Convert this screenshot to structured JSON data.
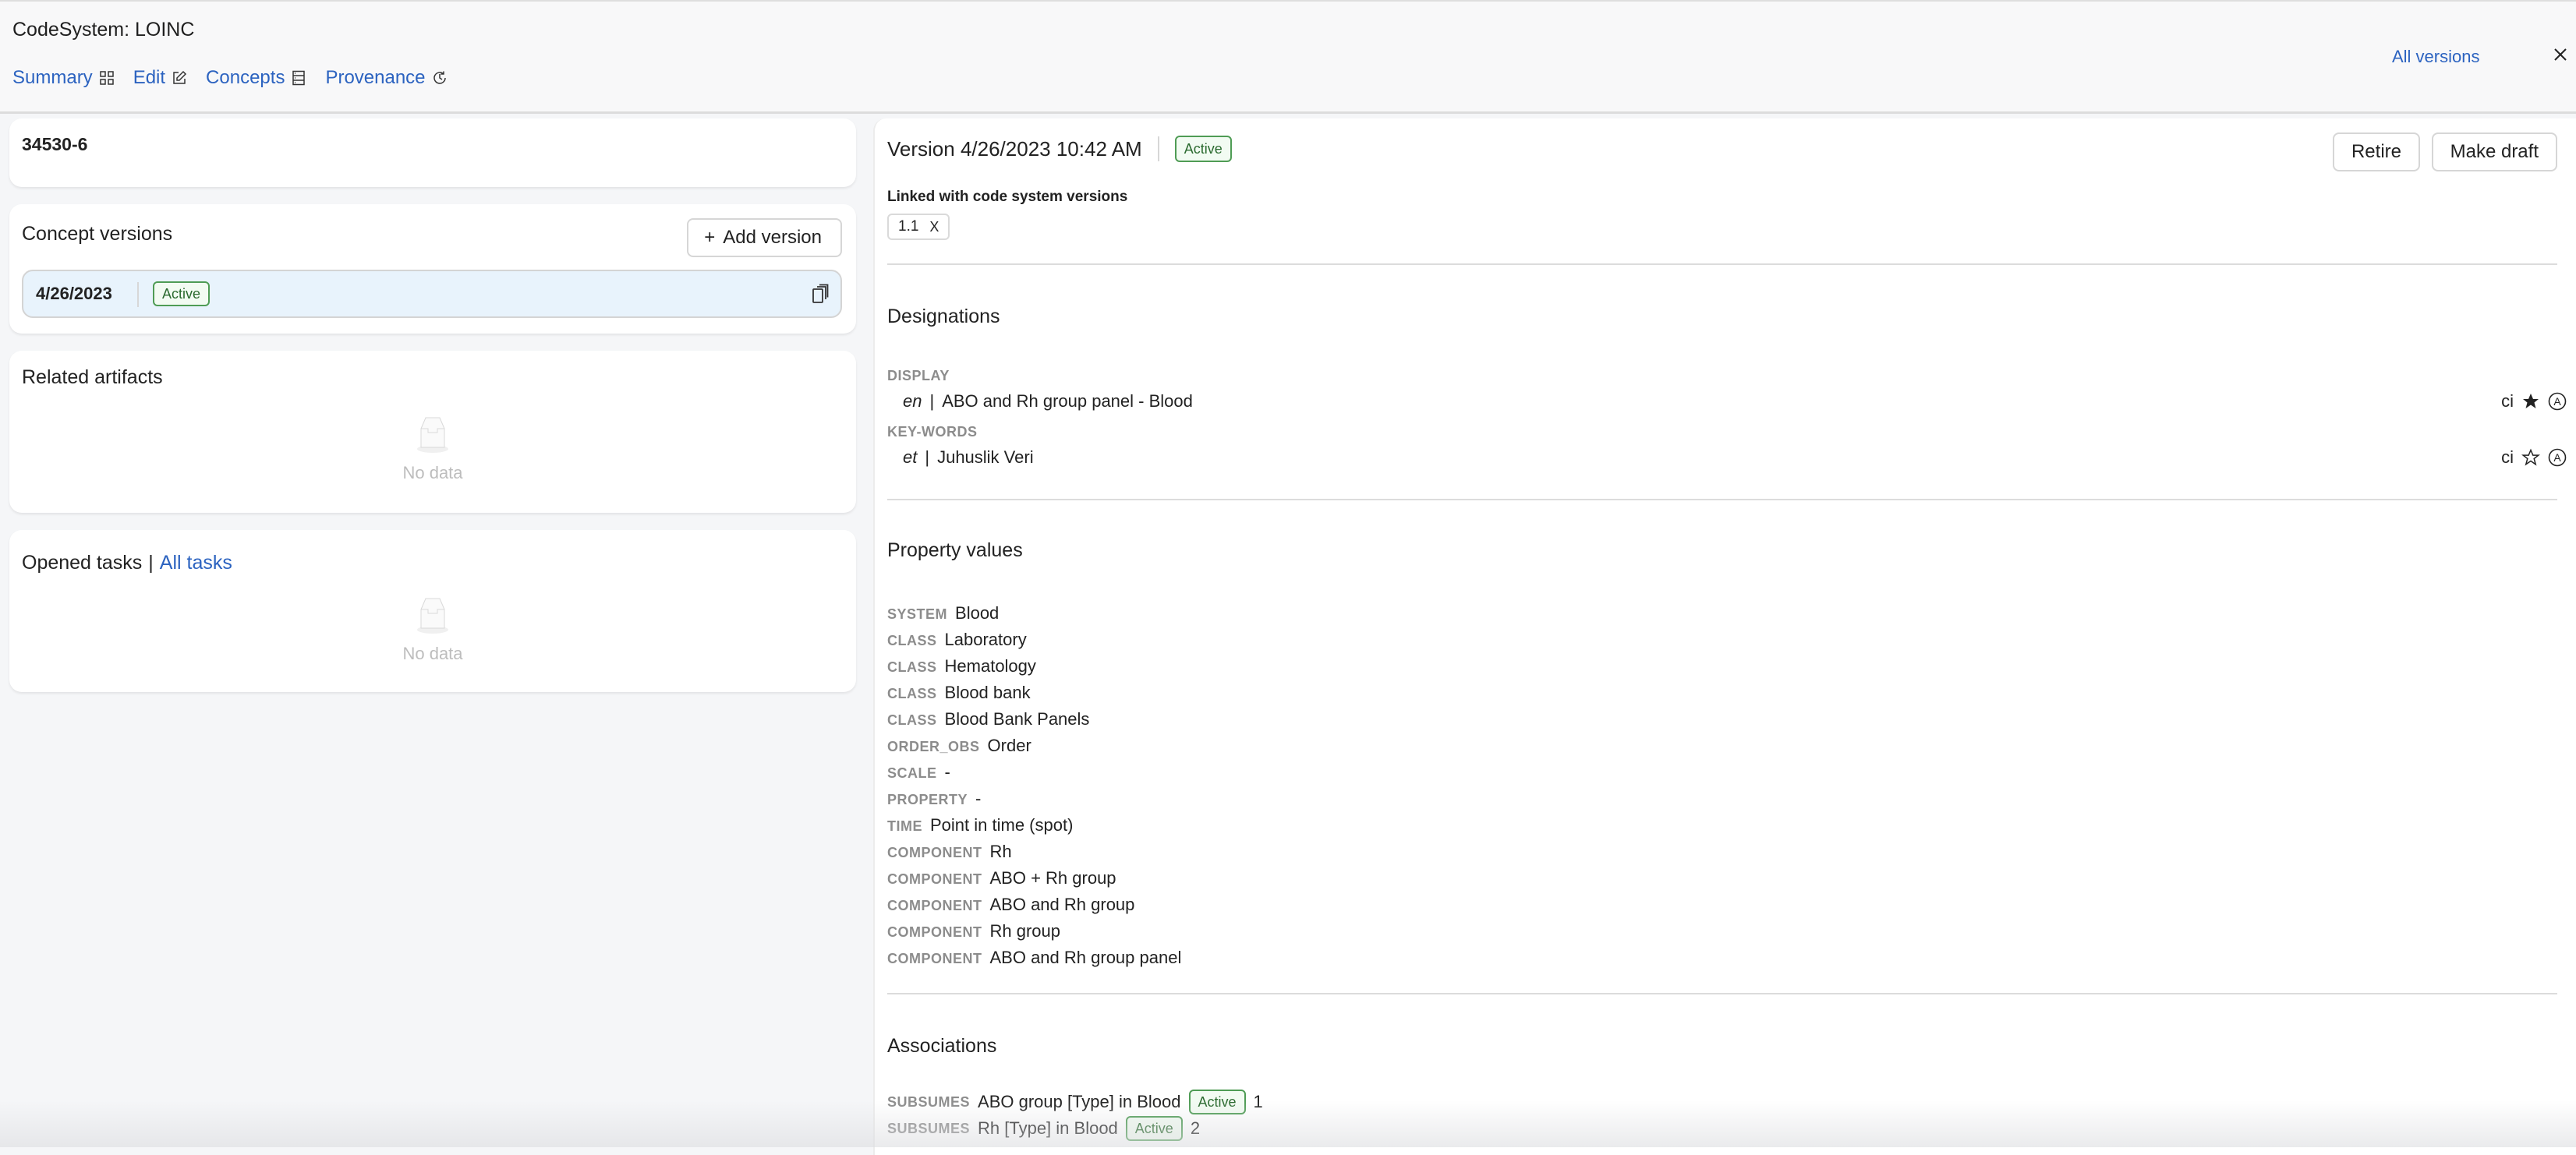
{
  "header": {
    "title": "CodeSystem: LOINC",
    "tabs": [
      {
        "label": "Summary",
        "icon": "grid-icon"
      },
      {
        "label": "Edit",
        "icon": "edit-icon"
      },
      {
        "label": "Concepts",
        "icon": "list-icon"
      },
      {
        "label": "Provenance",
        "icon": "history-icon"
      }
    ],
    "all_versions": "All versions",
    "close_icon": "close-icon"
  },
  "left": {
    "concept_code": "34530-6",
    "concept_versions": {
      "title": "Concept versions",
      "add_button": "Add version",
      "add_icon": "+",
      "items": [
        {
          "date": "4/26/2023",
          "status": "Active"
        }
      ]
    },
    "related_artifacts": {
      "title": "Related artifacts",
      "empty_text": "No data"
    },
    "opened_tasks": {
      "title": "Opened tasks",
      "separator": "|",
      "link": "All tasks",
      "empty_text": "No data"
    }
  },
  "version": {
    "title": "Version 4/26/2023 10:42 AM",
    "status": "Active",
    "buttons": {
      "retire": "Retire",
      "make_draft": "Make draft"
    },
    "linked_label": "Linked with code system versions",
    "linked_versions": [
      {
        "label": "1.1",
        "remove": "X"
      }
    ],
    "designations": {
      "title": "Designations",
      "groups": [
        {
          "type": "DISPLAY",
          "lang": "en",
          "sep": "|",
          "value": "ABO and Rh group panel - Blood",
          "case": "ci",
          "preferred": true,
          "status_icon": "A"
        },
        {
          "type": "KEY-WORDS",
          "lang": "et",
          "sep": "|",
          "value": "Juhuslik Veri",
          "case": "ci",
          "preferred": false,
          "status_icon": "A"
        }
      ]
    },
    "properties": {
      "title": "Property values",
      "items": [
        {
          "key": "SYSTEM",
          "value": "Blood"
        },
        {
          "key": "CLASS",
          "value": "Laboratory"
        },
        {
          "key": "CLASS",
          "value": "Hematology"
        },
        {
          "key": "CLASS",
          "value": "Blood bank"
        },
        {
          "key": "CLASS",
          "value": "Blood Bank Panels"
        },
        {
          "key": "ORDER_OBS",
          "value": "Order"
        },
        {
          "key": "SCALE",
          "value": "-"
        },
        {
          "key": "PROPERTY",
          "value": "-"
        },
        {
          "key": "TIME",
          "value": "Point in time (spot)"
        },
        {
          "key": "COMPONENT",
          "value": "Rh"
        },
        {
          "key": "COMPONENT",
          "value": "ABO + Rh group"
        },
        {
          "key": "COMPONENT",
          "value": "ABO and Rh group"
        },
        {
          "key": "COMPONENT",
          "value": "Rh group"
        },
        {
          "key": "COMPONENT",
          "value": "ABO and Rh group panel"
        }
      ]
    },
    "associations": {
      "title": "Associations",
      "items": [
        {
          "type": "SUBSUMES",
          "target": "ABO group [Type] in Blood",
          "status": "Active",
          "order": "1"
        },
        {
          "type": "SUBSUMES",
          "target": "Rh [Type] in Blood",
          "status": "Active",
          "order": "2"
        }
      ]
    }
  },
  "colors": {
    "link": "#2c63c0",
    "active_border": "#4f9c55",
    "active_bg": "#f2fbf2",
    "selected_version_bg": "#e8f3fc",
    "muted_label": "#8c8c8c"
  }
}
